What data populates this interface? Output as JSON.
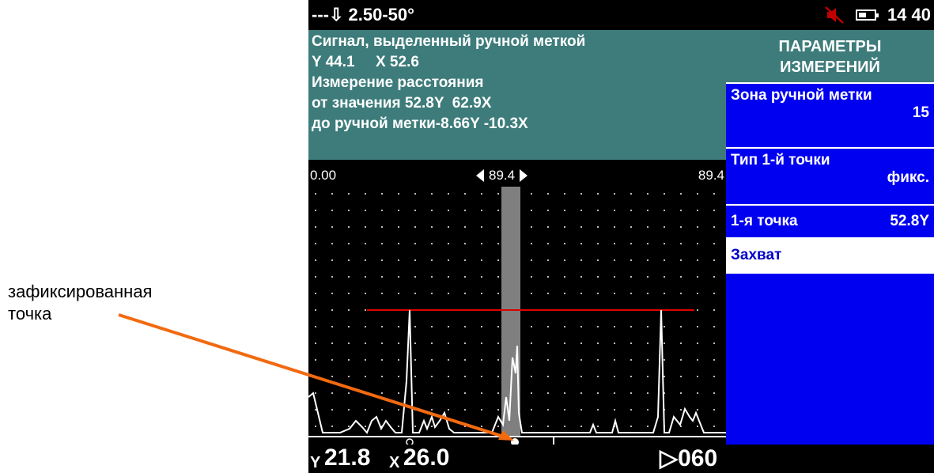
{
  "status": {
    "probe_text": "---⇩ 2.50-50°",
    "time": "14 40",
    "icons": [
      "mute-icon",
      "battery-icon"
    ]
  },
  "info": {
    "line1": "Сигнал, выделенный ручной меткой",
    "line2": "Y 44.1     X 52.6",
    "line3": "Измерение расстояния",
    "line4": "от значения 52.8Y  62.9X",
    "line5": "до ручной метки-8.66Y -10.3X"
  },
  "scale": {
    "left": "0.00",
    "center": "89.4",
    "right": "89.4"
  },
  "readout": {
    "y_label": "Y",
    "y_value": "21.8",
    "x_label": "X",
    "x_value": "26.0",
    "right_value": "▷060"
  },
  "menu": {
    "header_line1": "ПАРАМЕТРЫ",
    "header_line2": "ИЗМЕРЕНИЙ",
    "items": [
      {
        "label": "Зона ручной метки",
        "value": "15"
      },
      {
        "label": "Тип 1-й точки",
        "value": "фикс."
      },
      {
        "label": "1-я точка",
        "value": "52.8Y"
      },
      {
        "label": "Захват",
        "value": ""
      }
    ]
  },
  "annotation": {
    "line1": "зафиксированная",
    "line2": "точка"
  },
  "colors": {
    "info_bg": "#3d7c7b",
    "menu_bg": "#0000f0",
    "gate_line": "#e00000",
    "arrow": "#f26a10",
    "marker_band": "#7f7f7f"
  }
}
